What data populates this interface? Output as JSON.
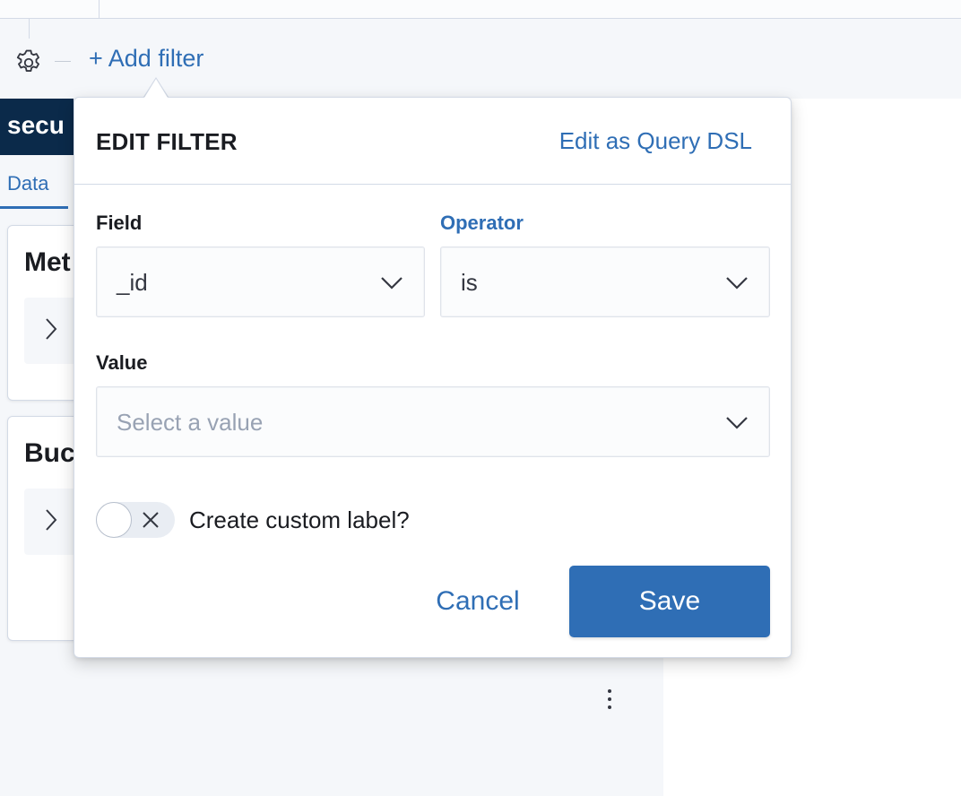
{
  "filter_bar": {
    "settings_icon": "gear-icon",
    "add_filter_label": "+ Add filter"
  },
  "background": {
    "header_title": "secu",
    "data_tab_label": "Data",
    "cards": [
      {
        "title": "Met",
        "expand_icon": "chevron-right-icon"
      },
      {
        "title": "Buc",
        "expand_icon": "chevron-right-icon"
      }
    ],
    "more_icon": "kebab-vertical-icon"
  },
  "edit_filter": {
    "title": "EDIT FILTER",
    "query_dsl_link": "Edit as Query DSL",
    "field": {
      "label": "Field",
      "value": "_id"
    },
    "operator": {
      "label": "Operator",
      "value": "is"
    },
    "value": {
      "label": "Value",
      "placeholder": "Select a value"
    },
    "custom_label_toggle": {
      "label": "Create custom label?",
      "checked": false
    },
    "cancel_label": "Cancel",
    "save_label": "Save"
  },
  "colors": {
    "accent": "#2f6eb5",
    "header_dark": "#0b2a4a",
    "text": "#1a1c21",
    "placeholder": "#98a2b3",
    "border": "#d3dae6",
    "panel_bg": "#f5f7fa"
  }
}
